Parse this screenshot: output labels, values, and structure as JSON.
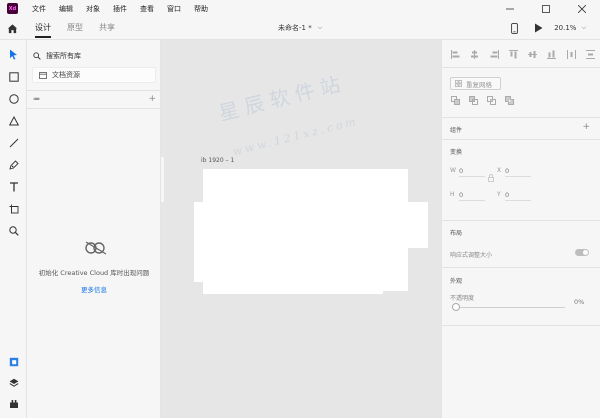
{
  "app": {
    "logo": "Xd",
    "accent": "#470137"
  },
  "menu": [
    "文件",
    "编辑",
    "对象",
    "插件",
    "查看",
    "窗口",
    "帮助"
  ],
  "tabs": [
    {
      "label": "设计",
      "active": true
    },
    {
      "label": "原型",
      "active": false
    },
    {
      "label": "共享",
      "active": false
    }
  ],
  "document": {
    "title": "未命名-1 *"
  },
  "zoom": "20.1%",
  "library": {
    "search_placeholder": "搜索所有库",
    "document_assets": "文档资源",
    "list_icon": "≔",
    "cc_message": "初始化 Creative Cloud 库时出现问题",
    "cc_link": "更多信息",
    "link_color": "#1473e6"
  },
  "canvas": {
    "artboard_label": "ib 1920 – 1",
    "watermark_main": "星辰软件站",
    "watermark_url": "www.121xz.com"
  },
  "inspector": {
    "repeat_grid": "重复网格",
    "components": "组件",
    "transform": "变换",
    "fields": {
      "w_label": "W",
      "w_value": "0",
      "x_label": "X",
      "x_value": "0",
      "h_label": "H",
      "h_value": "0",
      "y_label": "Y",
      "y_value": "0"
    },
    "layout": "布局",
    "responsive_resize": "响应式调整大小",
    "appearance": "外观",
    "opacity_label": "不透明度",
    "opacity_value": "0%"
  }
}
